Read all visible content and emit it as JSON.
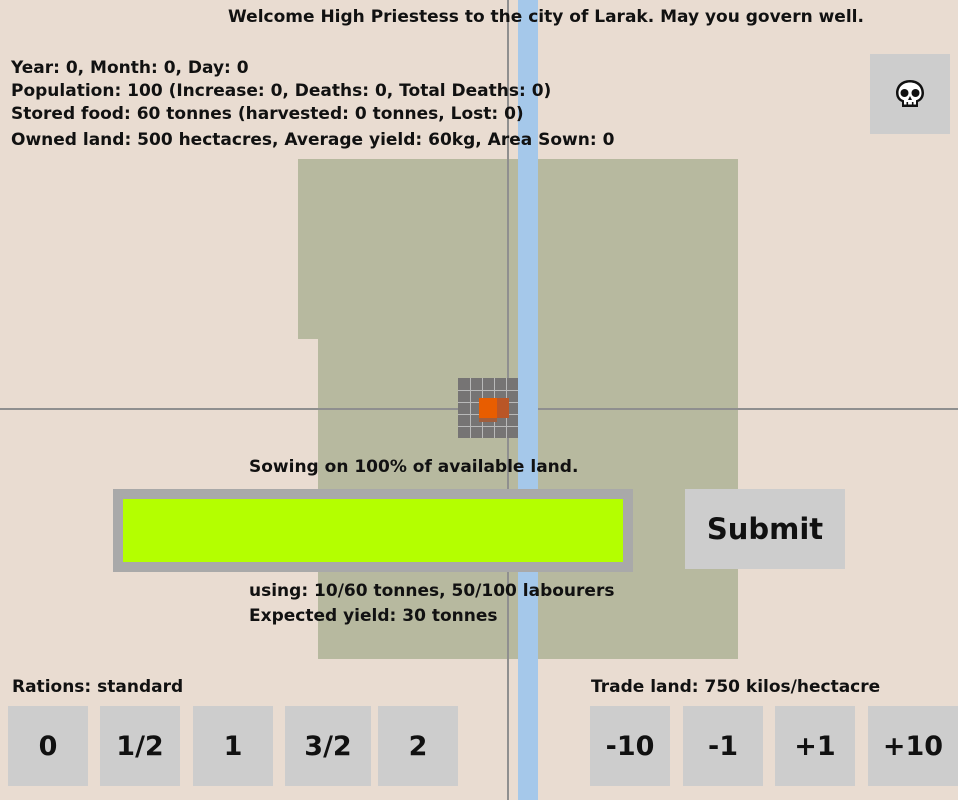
{
  "header": {
    "welcome": "Welcome High Priestess to the city of Larak. May you govern well."
  },
  "stats": {
    "date": "Year: 0, Month: 0, Day: 0",
    "population": "Population: 100 (Increase: 0, Deaths: 0, Total Deaths: 0)",
    "food": "Stored food: 60 tonnes (harvested:  0 tonnes, Lost: 0)",
    "land": "Owned land: 500 hectacres, Average yield: 60kg, Area Sown: 0"
  },
  "icons": {
    "death": "skull-icon"
  },
  "sowing": {
    "label": "Sowing on 100% of available land.",
    "level_percent": 100,
    "submit_label": "Submit",
    "using": "using: 10/60 tonnes, 50/100 labourers",
    "expected": "Expected yield: 30 tonnes"
  },
  "rations": {
    "label": "Rations: standard",
    "options": [
      "0",
      "1/2",
      "1",
      "3/2",
      "2"
    ]
  },
  "trade": {
    "label": "Trade land: 750 kilos/hectacre",
    "options": [
      "-10",
      "-1",
      "+1",
      "+10"
    ]
  },
  "colors": {
    "background": "#e9dcd1",
    "field": "#b7b99f",
    "river": "#a5c8ea",
    "slider_fill": "#b4ff00",
    "slider_track": "#a9a9a9",
    "button": "#cdcdcd",
    "city": "#767474",
    "city_fire": "#e85d00"
  }
}
